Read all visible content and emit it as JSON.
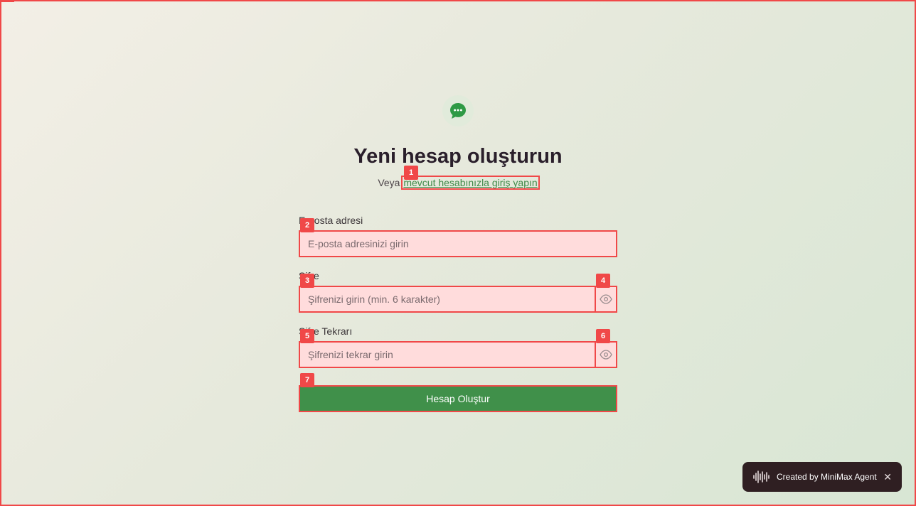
{
  "page": {
    "title": "Yeni hesap oluşturun",
    "subtitle_prefix": "Veya",
    "login_link": "mevcut hesabınızla giriş yapın"
  },
  "form": {
    "email": {
      "label": "E-posta adresi",
      "placeholder": "E-posta adresinizi girin",
      "value": ""
    },
    "password": {
      "label": "Şifre",
      "placeholder": "Şifrenizi girin (min. 6 karakter)",
      "value": ""
    },
    "password_confirm": {
      "label": "Şifre Tekrarı",
      "placeholder": "Şifrenizi tekrar girin",
      "value": ""
    },
    "submit_label": "Hesap Oluştur"
  },
  "annotations": {
    "login_link": "1",
    "email_input": "2",
    "password_input": "3",
    "password_toggle": "4",
    "confirm_input": "5",
    "confirm_toggle": "6",
    "submit_button": "7"
  },
  "toast": {
    "text": "Created by MiniMax Agent",
    "close": "✕"
  },
  "icons": {
    "logo": "chat-bubble-icon",
    "password_toggle": "eye-icon",
    "confirm_toggle": "eye-icon",
    "toast_logo": "waveform-icon"
  },
  "colors": {
    "accent": "#40904a",
    "annotation": "#f04848",
    "title": "#2a1f2b",
    "toast_bg": "#2f1f22"
  }
}
